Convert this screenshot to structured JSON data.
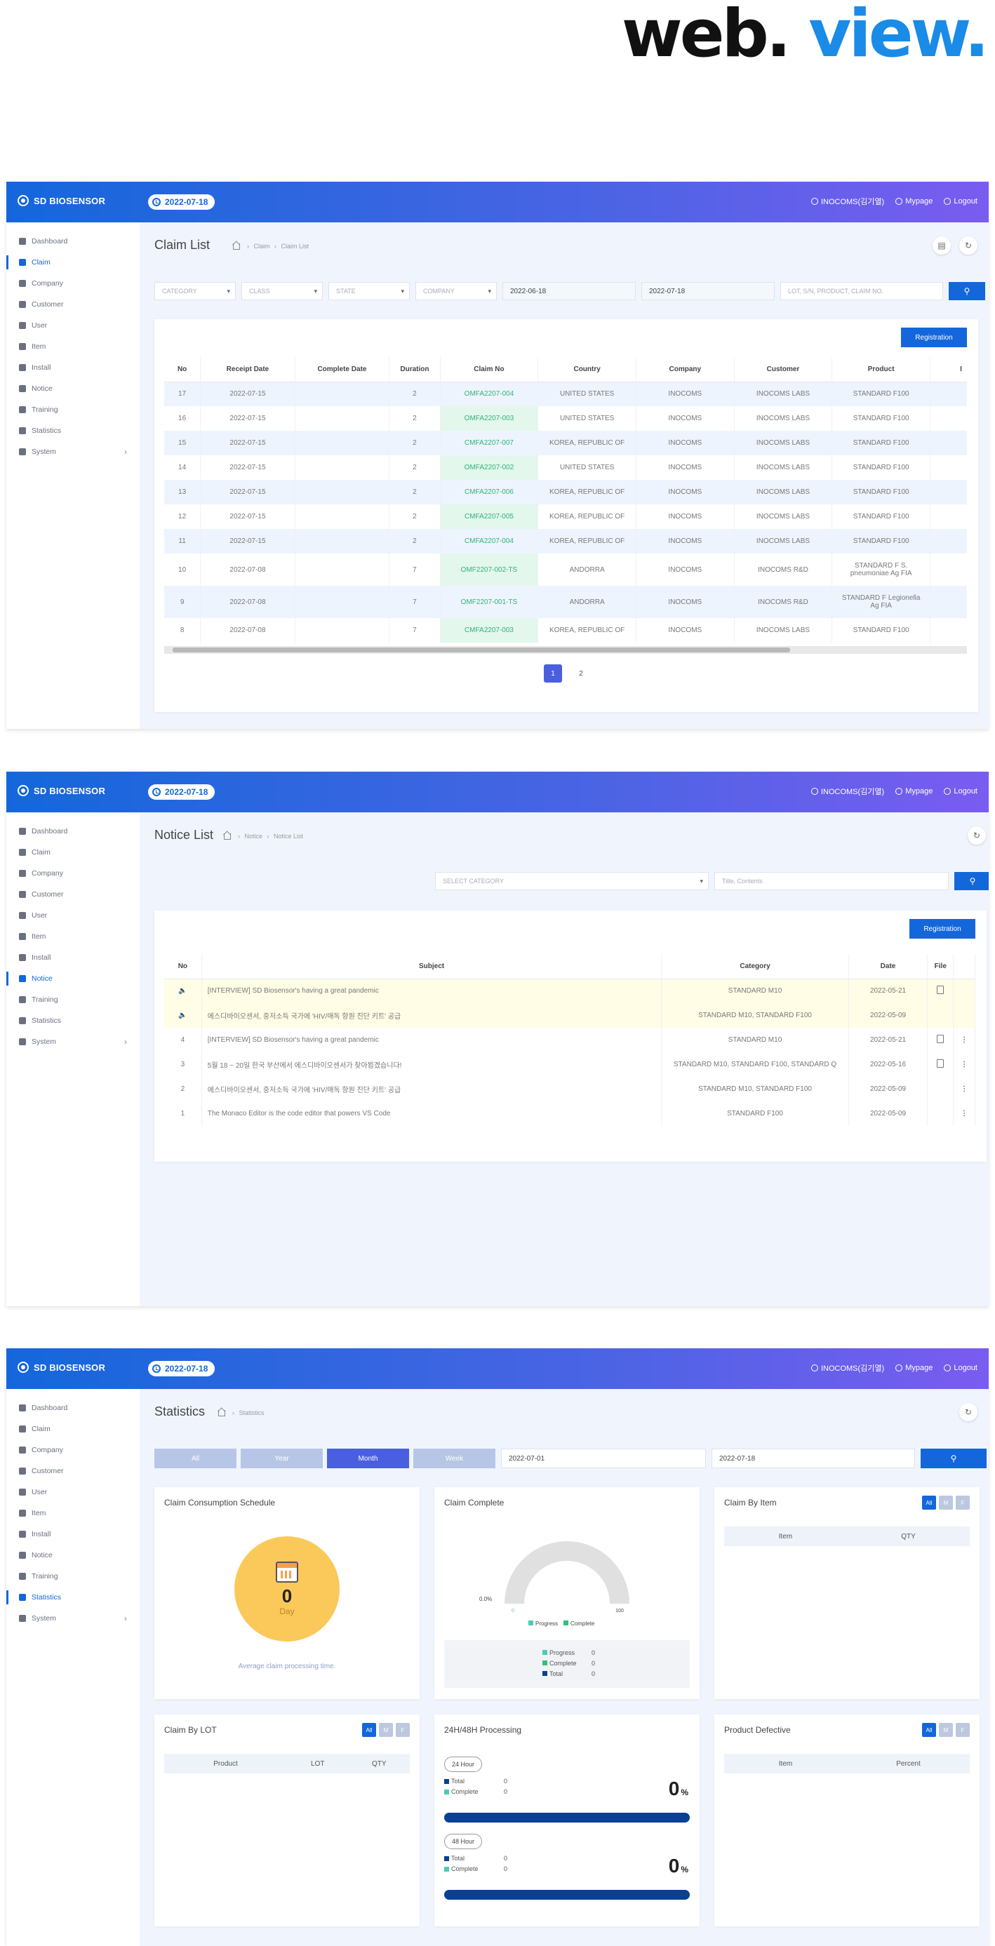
{
  "hero": {
    "word1": "web.",
    "word2": "view."
  },
  "app": {
    "brand": "SD BIOSENSOR",
    "date": "2022-07-18",
    "user": "INOCOMS(김기열)",
    "mypage": "Mypage",
    "logout": "Logout",
    "colors": {
      "primary": "#1467db",
      "gradient_end": "#7a5cf0",
      "claim_no_bg": "#e3f7ec",
      "claim_no_text": "#2fb47a",
      "gauge_fill": "#fbc85a"
    }
  },
  "nav": [
    {
      "label": "Dashboard",
      "icon": "globe-icon"
    },
    {
      "label": "Claim",
      "icon": "clipboard-icon"
    },
    {
      "label": "Company",
      "icon": "building-icon"
    },
    {
      "label": "Customer",
      "icon": "box-icon"
    },
    {
      "label": "User",
      "icon": "user-icon"
    },
    {
      "label": "Item",
      "icon": "puzzle-icon"
    },
    {
      "label": "Install",
      "icon": "download-icon"
    },
    {
      "label": "Notice",
      "icon": "microphone-icon"
    },
    {
      "label": "Training",
      "icon": "graduation-icon"
    },
    {
      "label": "Statistics",
      "icon": "bar-chart-icon"
    },
    {
      "label": "System",
      "icon": "gear-icon"
    }
  ],
  "claim": {
    "title": "Claim List",
    "crumb": [
      "Claim",
      "Claim List"
    ],
    "filters": {
      "category": "CATEGORY",
      "class": "CLASS",
      "state": "STATE",
      "company": "COMPANY",
      "from": "2022-06-18",
      "to": "2022-07-18",
      "search_placeholder": "LOT, S/N, PRODUCT, CLAIM NO."
    },
    "register": "Registration",
    "columns": [
      "No",
      "Receipt Date",
      "Complete Date",
      "Duration",
      "Claim No",
      "Country",
      "Company",
      "Customer",
      "Product",
      "I"
    ],
    "rows": [
      {
        "no": "17",
        "receipt": "2022-07-15",
        "complete": "",
        "duration": "2",
        "claim_no": "OMFA2207-004",
        "country": "UNITED STATES",
        "company": "INOCOMS",
        "customer": "INOCOMS LABS",
        "product": "STANDARD F100"
      },
      {
        "no": "16",
        "receipt": "2022-07-15",
        "complete": "",
        "duration": "2",
        "claim_no": "OMFA2207-003",
        "country": "UNITED STATES",
        "company": "INOCOMS",
        "customer": "INOCOMS LABS",
        "product": "STANDARD F100"
      },
      {
        "no": "15",
        "receipt": "2022-07-15",
        "complete": "",
        "duration": "2",
        "claim_no": "CMFA2207-007",
        "country": "KOREA, REPUBLIC OF",
        "company": "INOCOMS",
        "customer": "INOCOMS LABS",
        "product": "STANDARD F100"
      },
      {
        "no": "14",
        "receipt": "2022-07-15",
        "complete": "",
        "duration": "2",
        "claim_no": "OMFA2207-002",
        "country": "UNITED STATES",
        "company": "INOCOMS",
        "customer": "INOCOMS LABS",
        "product": "STANDARD F100"
      },
      {
        "no": "13",
        "receipt": "2022-07-15",
        "complete": "",
        "duration": "2",
        "claim_no": "CMFA2207-006",
        "country": "KOREA, REPUBLIC OF",
        "company": "INOCOMS",
        "customer": "INOCOMS LABS",
        "product": "STANDARD F100"
      },
      {
        "no": "12",
        "receipt": "2022-07-15",
        "complete": "",
        "duration": "2",
        "claim_no": "CMFA2207-005",
        "country": "KOREA, REPUBLIC OF",
        "company": "INOCOMS",
        "customer": "INOCOMS LABS",
        "product": "STANDARD F100"
      },
      {
        "no": "11",
        "receipt": "2022-07-15",
        "complete": "",
        "duration": "2",
        "claim_no": "CMFA2207-004",
        "country": "KOREA, REPUBLIC OF",
        "company": "INOCOMS",
        "customer": "INOCOMS LABS",
        "product": "STANDARD F100"
      },
      {
        "no": "10",
        "receipt": "2022-07-08",
        "complete": "",
        "duration": "7",
        "claim_no": "OMF2207-002-TS",
        "country": "ANDORRA",
        "company": "INOCOMS",
        "customer": "INOCOMS R&D",
        "product": "STANDARD F S. pneumoniae Ag FIA"
      },
      {
        "no": "9",
        "receipt": "2022-07-08",
        "complete": "",
        "duration": "7",
        "claim_no": "OMF2207-001-TS",
        "country": "ANDORRA",
        "company": "INOCOMS",
        "customer": "INOCOMS R&D",
        "product": "STANDARD F Legionella Ag FIA"
      },
      {
        "no": "8",
        "receipt": "2022-07-08",
        "complete": "",
        "duration": "7",
        "claim_no": "CMFA2207-003",
        "country": "KOREA, REPUBLIC OF",
        "company": "INOCOMS",
        "customer": "INOCOMS LABS",
        "product": "STANDARD F100"
      }
    ],
    "pages": [
      "1",
      "2"
    ]
  },
  "notice": {
    "title": "Notice List",
    "crumb": [
      "Notice",
      "Notice List"
    ],
    "category_placeholder": "SELECT CATEGORY",
    "search_placeholder": "Title, Contents",
    "register": "Registration",
    "columns": [
      "No",
      "Subject",
      "Category",
      "Date",
      "File"
    ],
    "rows": [
      {
        "no": "",
        "subject": "[INTERVIEW] SD Biosensor's having a great pandemic",
        "category": "STANDARD M10",
        "date": "2022-05-21",
        "pinned": true,
        "file": true,
        "menu": false
      },
      {
        "no": "",
        "subject": "에스디바이오센서, 중저소득 국가에 'HIV/매독 항원 진단 키트' 공급",
        "category": "STANDARD M10, STANDARD F100",
        "date": "2022-05-09",
        "pinned": true,
        "file": false,
        "menu": false
      },
      {
        "no": "4",
        "subject": "[INTERVIEW] SD Biosensor's having a great pandemic",
        "category": "STANDARD M10",
        "date": "2022-05-21",
        "pinned": false,
        "file": true,
        "menu": true
      },
      {
        "no": "3",
        "subject": "5월 18 ~ 20일 한국 부산에서 에스디바이오센서가 찾아뵙겠습니다!",
        "category": "STANDARD M10, STANDARD F100, STANDARD Q",
        "date": "2022-05-16",
        "pinned": false,
        "file": true,
        "menu": true
      },
      {
        "no": "2",
        "subject": "에스디바이오센서, 중저소득 국가에 'HIV/매독 항원 진단 키트' 공급",
        "category": "STANDARD M10, STANDARD F100",
        "date": "2022-05-09",
        "pinned": false,
        "file": false,
        "menu": true
      },
      {
        "no": "1",
        "subject": "The Monaco Editor is the code editor that powers VS Code",
        "category": "STANDARD F100",
        "date": "2022-05-09",
        "pinned": false,
        "file": false,
        "menu": true
      }
    ]
  },
  "stats": {
    "title": "Statistics",
    "crumb": [
      "Statistics"
    ],
    "tabs": [
      "All",
      "Year",
      "Month",
      "Week"
    ],
    "active_tab": "Month",
    "from": "2022-07-01",
    "to": "2022-07-18",
    "schedule": {
      "title": "Claim Consumption Schedule",
      "value": "0",
      "unit": "Day",
      "caption": "Average claim processing time."
    },
    "complete": {
      "title": "Claim Complete",
      "gauge_label": "0.0%",
      "gauge_min": "0",
      "gauge_max": "100",
      "gauge_value": 0,
      "legend": [
        "Progress",
        "Complete"
      ],
      "rows": [
        {
          "label": "Progress",
          "value": "0"
        },
        {
          "label": "Complete",
          "value": "0"
        },
        {
          "label": "Total",
          "value": "0"
        }
      ]
    },
    "by_item": {
      "title": "Claim By Item",
      "filters": [
        "All",
        "M",
        "F"
      ],
      "columns": [
        "Item",
        "QTY"
      ]
    },
    "by_lot": {
      "title": "Claim By LOT",
      "filters": [
        "All",
        "M",
        "F"
      ],
      "columns": [
        "Product",
        "LOT",
        "QTY"
      ]
    },
    "processing": {
      "title": "24H/48H Processing",
      "blocks": [
        {
          "label": "24 Hour",
          "rows": [
            {
              "label": "Total",
              "value": "0"
            },
            {
              "label": "Complete",
              "value": "0"
            }
          ],
          "percent": "0",
          "unit": "%"
        },
        {
          "label": "48 Hour",
          "rows": [
            {
              "label": "Total",
              "value": "0"
            },
            {
              "label": "Complete",
              "value": "0"
            }
          ],
          "percent": "0",
          "unit": "%"
        }
      ]
    },
    "defective": {
      "title": "Product Defective",
      "filters": [
        "All",
        "M",
        "F"
      ],
      "columns": [
        "Item",
        "Percent"
      ]
    }
  }
}
